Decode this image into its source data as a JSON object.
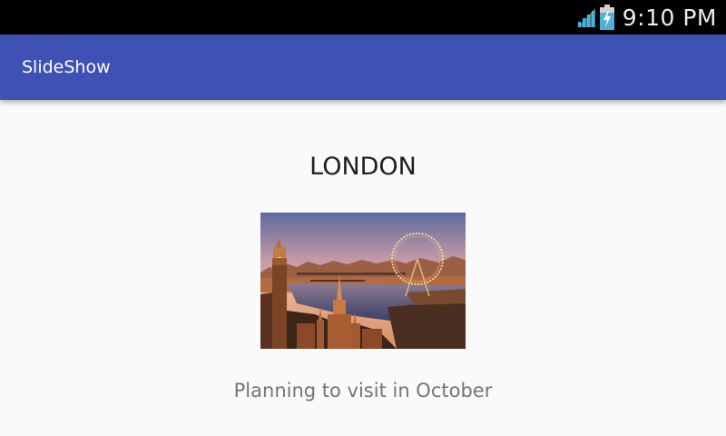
{
  "status_bar": {
    "time": "9:10 PM",
    "icons": [
      "signal-icon",
      "battery-charging-icon"
    ]
  },
  "app_bar": {
    "title": "SlideShow",
    "color": "#3f51b5"
  },
  "slide": {
    "title": "LONDON",
    "caption": "Planning to visit in October",
    "image": "london-cityscape-photo"
  }
}
